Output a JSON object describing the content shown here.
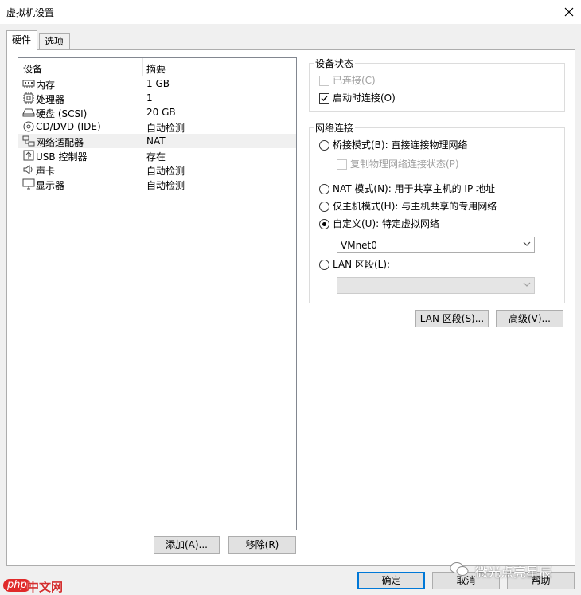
{
  "window": {
    "title": "虚拟机设置"
  },
  "tabs": [
    {
      "label": "硬件"
    },
    {
      "label": "选项"
    }
  ],
  "device_list": {
    "columns": {
      "device": "设备",
      "summary": "摘要"
    },
    "rows": [
      {
        "name": "内存",
        "summary": "1 GB",
        "icon": "memory-icon"
      },
      {
        "name": "处理器",
        "summary": "1",
        "icon": "processor-icon"
      },
      {
        "name": "硬盘 (SCSI)",
        "summary": "20 GB",
        "icon": "hard-disk-icon"
      },
      {
        "name": "CD/DVD (IDE)",
        "summary": "自动检测",
        "icon": "cd-dvd-icon"
      },
      {
        "name": "网络适配器",
        "summary": "NAT",
        "icon": "network-adapter-icon"
      },
      {
        "name": "USB 控制器",
        "summary": "存在",
        "icon": "usb-icon"
      },
      {
        "name": "声卡",
        "summary": "自动检测",
        "icon": "sound-card-icon"
      },
      {
        "name": "显示器",
        "summary": "自动检测",
        "icon": "display-icon"
      }
    ],
    "add_button": "添加(A)...",
    "remove_button": "移除(R)"
  },
  "device_status": {
    "title": "设备状态",
    "connected": {
      "label": "已连接(C)",
      "checked": false,
      "disabled": true
    },
    "connect_at_power_on": {
      "label": "启动时连接(O)",
      "checked": true
    }
  },
  "network_connection": {
    "title": "网络连接",
    "bridged": {
      "label": "桥接模式(B): 直接连接物理网络",
      "selected": false
    },
    "replicate": {
      "label": "复制物理网络连接状态(P)",
      "checked": false,
      "disabled": true
    },
    "nat": {
      "label": "NAT 模式(N): 用于共享主机的 IP 地址",
      "selected": false
    },
    "host_only": {
      "label": "仅主机模式(H): 与主机共享的专用网络",
      "selected": false
    },
    "custom": {
      "label": "自定义(U): 特定虚拟网络",
      "selected": true
    },
    "vmnet_select": {
      "value": "VMnet0"
    },
    "lan_segment": {
      "label": "LAN 区段(L):",
      "selected": false
    },
    "lan_segment_select": {
      "value": ""
    }
  },
  "buttons": {
    "lan_segments": "LAN 区段(S)...",
    "advanced": "高级(V)...",
    "ok": "确定",
    "cancel": "取消",
    "help": "帮助"
  },
  "watermark": {
    "text": "微光点亮星辰"
  },
  "site_logo": {
    "php": "php",
    "text": "中文网"
  },
  "colors": {
    "focus_blue": "#0078d7",
    "selection_gray": "#f0f0f0",
    "border": "#adadad"
  }
}
